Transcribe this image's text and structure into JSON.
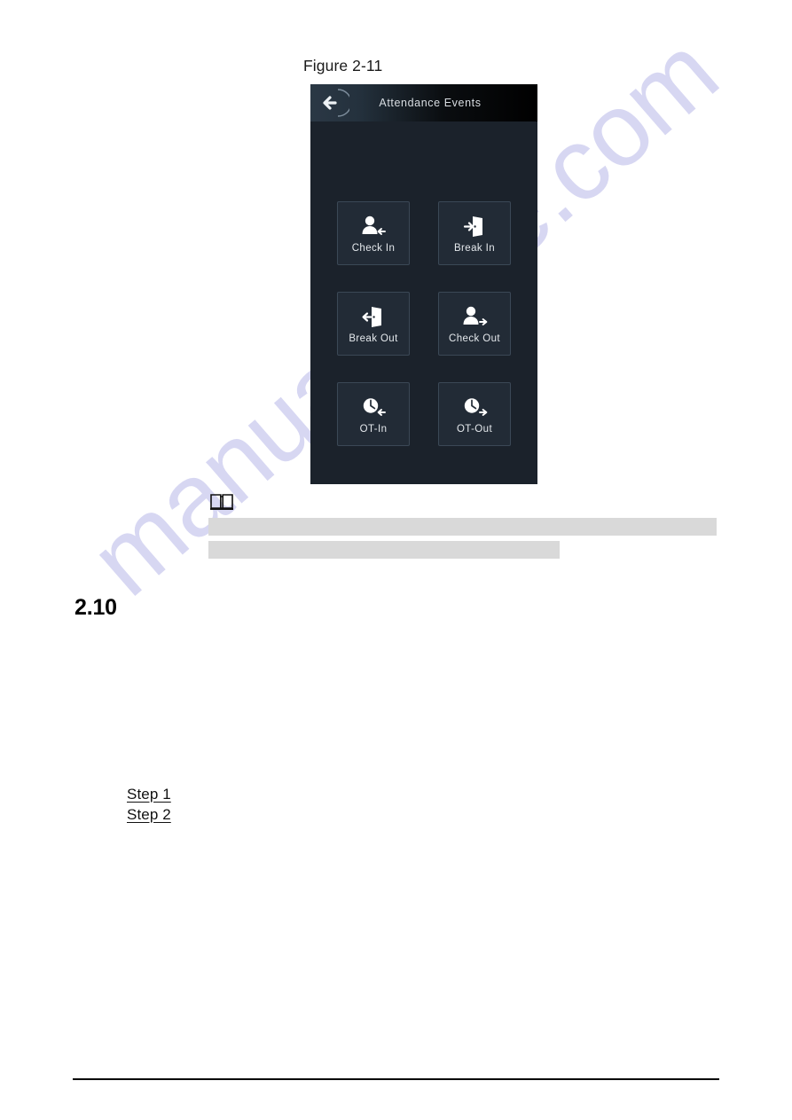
{
  "page": {
    "figure_caption": "Figure 2-11",
    "section_number": "2.10",
    "steps": [
      {
        "label": "Step 1"
      },
      {
        "label": "Step 2"
      }
    ],
    "watermark": "manualshive.com",
    "colors": {
      "page_background": "#ffffff",
      "watermark": "#c8c8ee",
      "redacted_bar": "#d9d9d9",
      "footer_rule": "#000000"
    }
  },
  "device": {
    "header": {
      "title": "Attendance Events",
      "back_icon": "back-arrow-icon"
    },
    "colors": {
      "screen_background": "#1b222b",
      "header_left": "#2b3845",
      "header_right": "#000000",
      "button_fill": "#222b36",
      "button_border": "#3b4856",
      "label_text": "#e4e8ec"
    },
    "buttons": [
      {
        "label": "Check In",
        "icon": "person-arrow-in-icon"
      },
      {
        "label": "Break In",
        "icon": "door-arrow-in-icon"
      },
      {
        "label": "Break Out",
        "icon": "door-arrow-out-icon"
      },
      {
        "label": "Check Out",
        "icon": "person-arrow-out-icon"
      },
      {
        "label": "OT-In",
        "icon": "clock-arrow-in-icon"
      },
      {
        "label": "OT-Out",
        "icon": "clock-arrow-out-icon"
      }
    ]
  },
  "note": {
    "icon": "open-book-icon",
    "redacted_lines": 2
  }
}
